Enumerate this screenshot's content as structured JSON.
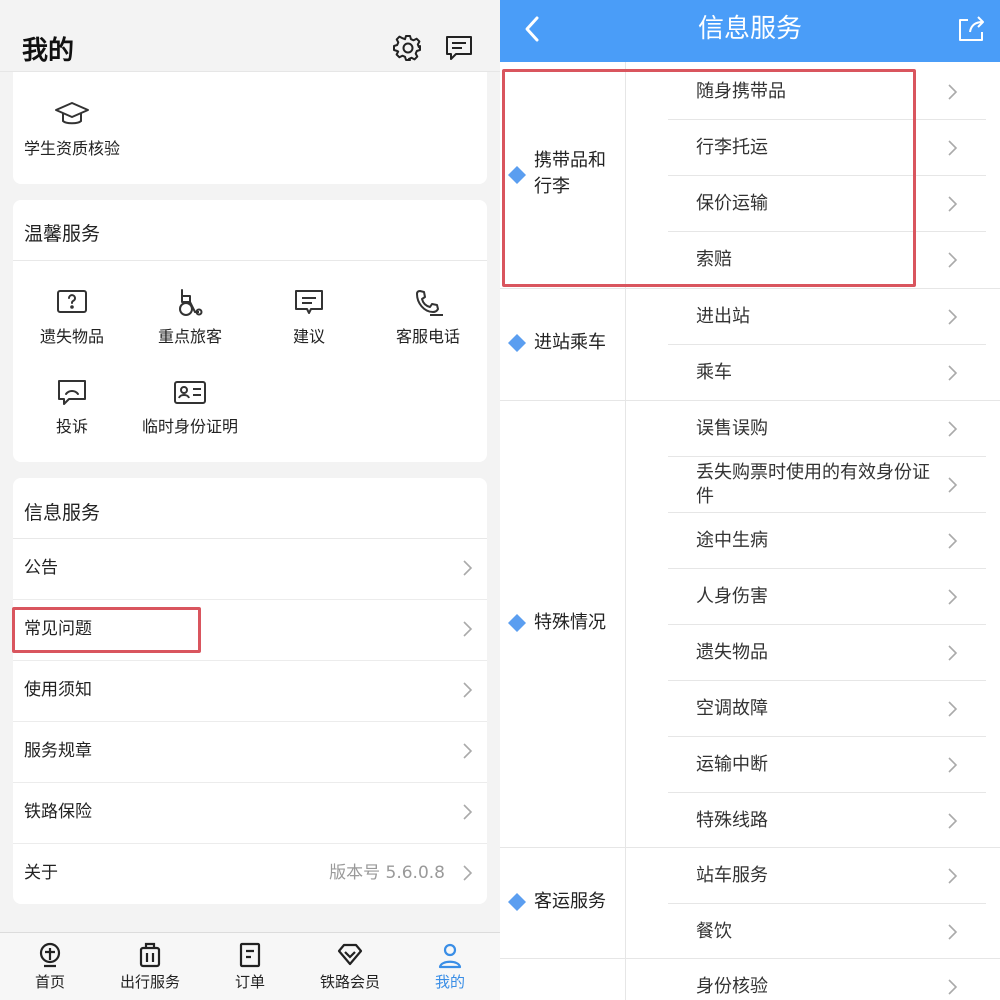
{
  "left": {
    "header": {
      "title": "我的",
      "settings_icon": "gear-icon",
      "message_icon": "message-icon"
    },
    "student": {
      "label": "学生资质核验",
      "icon": "graduation-cap-icon"
    },
    "warm_service": {
      "title": "温馨服务",
      "items": [
        {
          "label": "遗失物品",
          "icon": "question-box-icon"
        },
        {
          "label": "重点旅客",
          "icon": "wheelchair-icon"
        },
        {
          "label": "建议",
          "icon": "comment-icon"
        },
        {
          "label": "客服电话",
          "icon": "phone-icon"
        },
        {
          "label": "投诉",
          "icon": "complaint-icon"
        },
        {
          "label": "临时身份证明",
          "icon": "id-card-icon"
        }
      ]
    },
    "info_service": {
      "title": "信息服务",
      "rows": [
        {
          "label": "公告",
          "value": ""
        },
        {
          "label": "常见问题",
          "value": ""
        },
        {
          "label": "使用须知",
          "value": ""
        },
        {
          "label": "服务规章",
          "value": ""
        },
        {
          "label": "铁路保险",
          "value": ""
        },
        {
          "label": "关于",
          "value": "版本号 5.6.0.8"
        }
      ]
    },
    "tabbar": [
      {
        "label": "首页",
        "icon": "railway-logo-icon",
        "active": false
      },
      {
        "label": "出行服务",
        "icon": "luggage-icon",
        "active": false
      },
      {
        "label": "订单",
        "icon": "order-icon",
        "active": false
      },
      {
        "label": "铁路会员",
        "icon": "diamond-icon",
        "active": false
      },
      {
        "label": "我的",
        "icon": "user-icon",
        "active": true
      }
    ]
  },
  "right": {
    "header": {
      "title": "信息服务",
      "back_icon": "back-arrow-icon",
      "share_icon": "share-icon"
    },
    "categories": [
      {
        "label_line1": "携带品和",
        "label_line2": "行李",
        "items": [
          "随身携带品",
          "行李托运",
          "保价运输",
          "索赔"
        ]
      },
      {
        "label_line1": "进站乘车",
        "label_line2": "",
        "items": [
          "进出站",
          "乘车"
        ]
      },
      {
        "label_line1": "特殊情况",
        "label_line2": "",
        "items": [
          "误售误购",
          "丢失购票时使用的有效身份证件",
          "途中生病",
          "人身伤害",
          "遗失物品",
          "空调故障",
          "运输中断",
          "特殊线路"
        ]
      },
      {
        "label_line1": "客运服务",
        "label_line2": "",
        "items": [
          "站车服务",
          "餐饮",
          "身份核验"
        ]
      }
    ]
  },
  "colors": {
    "brand_blue": "#4a9df8",
    "diamond_blue": "#5b9ef0",
    "highlight_red": "#d9555e",
    "active_tab": "#3a8ee6"
  }
}
